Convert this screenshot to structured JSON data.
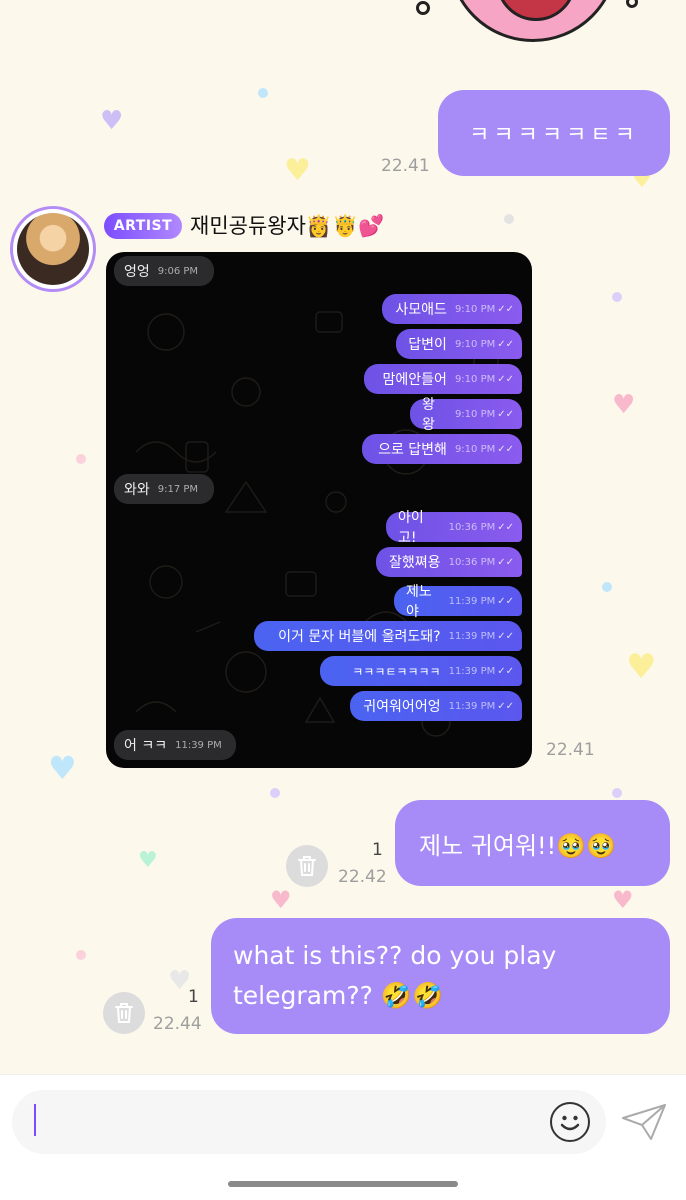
{
  "messages": {
    "m1": {
      "text": "ㅋㅋㅋㅋㅋㅌㅋ",
      "time": "22.41"
    },
    "artist": {
      "badge": "ARTIST",
      "name": "재민공듀왕자👸🤴💕",
      "time": "22.41"
    },
    "m3": {
      "text": "제노 귀여워!!🥹🥹",
      "time": "22.42",
      "unread": "1"
    },
    "m4": {
      "text": "what is this?? do you play telegram?? 🤣🤣",
      "time": "22.44",
      "unread": "1"
    }
  },
  "screenshot": {
    "incoming": [
      {
        "text": "엉엉",
        "time": "9:06 PM"
      },
      {
        "text": "와와",
        "time": "9:17 PM"
      },
      {
        "text": "어 ㅋㅋ",
        "time": "11:39 PM"
      }
    ],
    "outgoing": [
      {
        "text": "사모애드",
        "time": "9:10 PM"
      },
      {
        "text": "답변이",
        "time": "9:10 PM"
      },
      {
        "text": "맘에안들어",
        "time": "9:10 PM"
      },
      {
        "text": "왕왕",
        "time": "9:10 PM"
      },
      {
        "text": "으로 답변해",
        "time": "9:10 PM"
      },
      {
        "text": "아이고!",
        "time": "10:36 PM"
      },
      {
        "text": "잘했쪄용",
        "time": "10:36 PM"
      },
      {
        "text": "제노야",
        "time": "11:39 PM"
      },
      {
        "text": "이거 문자 버블에 올려도돼?",
        "time": "11:39 PM"
      },
      {
        "text": "ㅋㅋㅋㅌㅋㅋㅋㅋ",
        "time": "11:39 PM"
      },
      {
        "text": "귀여워어어엉",
        "time": "11:39 PM"
      }
    ]
  },
  "icons": {
    "trash": "trash-icon",
    "emoji": "smiley-icon",
    "send": "paper-plane-icon"
  },
  "colors": {
    "background": "#fdf8ec",
    "bubble": "#a78bf7",
    "accent": "#7c4dff"
  }
}
